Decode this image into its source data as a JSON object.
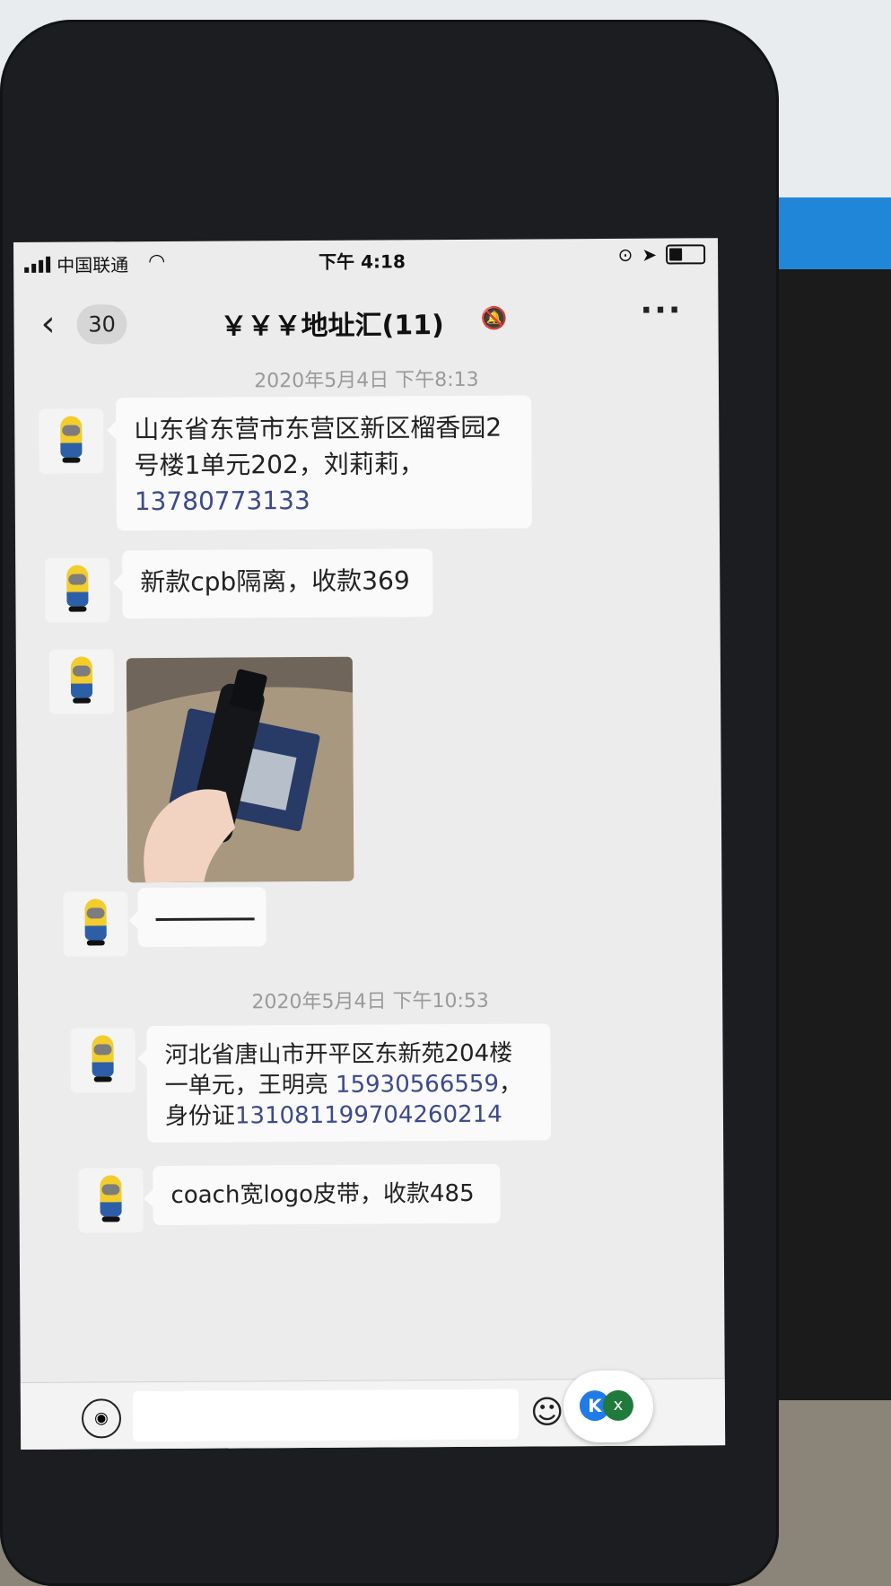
{
  "status_bar": {
    "carrier": "中国联通",
    "time": "下午 4:18"
  },
  "nav": {
    "back_count": "30",
    "title": "￥￥￥地址汇(11)"
  },
  "messages": {
    "timestamp_1": "2020年5月4日 下午8:13",
    "msg_1_text": "山东省东营市东营区新区榴香园2号楼1单元202，刘莉莉，",
    "msg_1_phone": "13780773133",
    "msg_2_text": "新款cpb隔离，收款369",
    "timestamp_2": "2020年5月4日 下午10:53",
    "msg_4_text": "河北省唐山市开平区东新苑204楼一单元，王明亮 ",
    "msg_4_phone": "15930566559",
    "msg_4_text_2": "，身份证",
    "msg_4_id": "131081199704260214",
    "msg_5_text": "coach宽logo皮带，收款485"
  },
  "input_bar": {
    "float_badge_a": "K",
    "float_badge_b": "x"
  },
  "icons": [
    "signal-icon",
    "wifi-icon",
    "lock-rotation-icon",
    "location-icon",
    "battery-icon",
    "back-chevron-icon",
    "mute-bell-icon",
    "more-icon",
    "voice-icon",
    "emoji-icon"
  ]
}
